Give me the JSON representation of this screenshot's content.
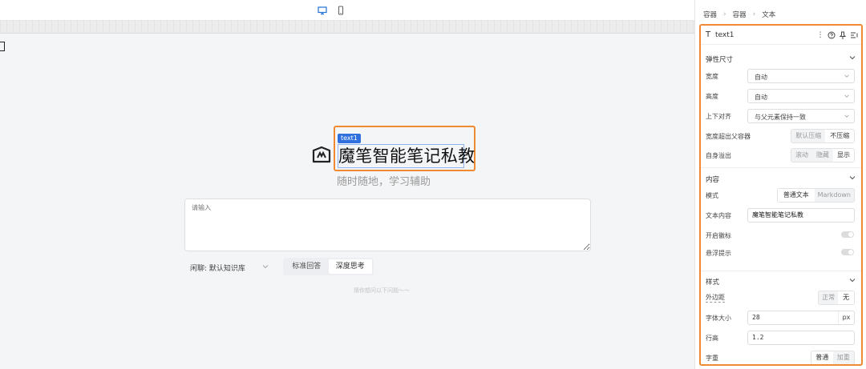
{
  "canvas": {
    "device_icons": [
      "desktop-icon",
      "mobile-icon"
    ],
    "selection_tag": "text1",
    "title": "魔笔智能笔记私教",
    "subtitle": "随时随地，学习辅助",
    "input_placeholder": "请输入",
    "knowledge_base": "闲聊: 默认知识库",
    "modes": [
      "标准回答",
      "深度思考"
    ],
    "guess_hint": "猜你想问以下问题～～"
  },
  "panel": {
    "breadcrumb": [
      "容器",
      "容器",
      "文本"
    ],
    "component_name": "text1",
    "sections": {
      "flex_size": {
        "title": "弹性尺寸",
        "width_label": "宽度",
        "width_value": "自动",
        "height_label": "高度",
        "height_value": "自动",
        "valign_label": "上下对齐",
        "valign_value": "与父元素保持一致",
        "overflow_parent_label": "宽度超出父容器",
        "overflow_parent_options": [
          "默认压缩",
          "不压缩"
        ],
        "self_overflow_label": "自身溢出",
        "self_overflow_options": [
          "滚动",
          "隐藏",
          "显示"
        ]
      },
      "content": {
        "title": "内容",
        "mode_label": "模式",
        "mode_options": [
          "普通文本",
          "Markdown"
        ],
        "text_label": "文本内容",
        "text_value": "魔笔智能笔记私教",
        "badge_label": "开启徽标",
        "tooltip_label": "悬浮提示"
      },
      "style": {
        "title": "样式",
        "margin_label": "外边距",
        "margin_options": [
          "正常",
          "无"
        ],
        "font_size_label": "字体大小",
        "font_size_value": "28",
        "font_size_unit": "px",
        "line_height_label": "行高",
        "line_height_value": "1.2",
        "font_weight_label": "字重",
        "font_weight_options": [
          "普通",
          "加重"
        ]
      }
    }
  },
  "colors": {
    "accent": "#2f6fde",
    "highlight": "#ef8a33"
  }
}
